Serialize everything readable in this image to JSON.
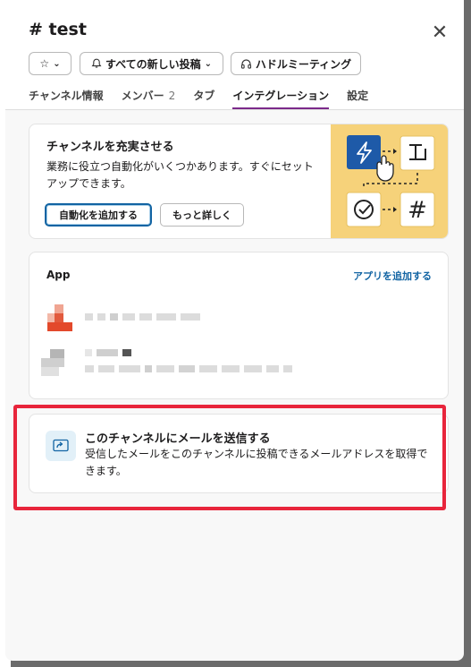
{
  "channel": {
    "title": "# test"
  },
  "header_buttons": {
    "star_chevron": "⌄",
    "notifications_label": "すべての新しい投稿",
    "huddle_label": "ハドルミーティング"
  },
  "tabs": [
    {
      "label": "チャンネル情報",
      "count": ""
    },
    {
      "label": "メンバー",
      "count": "2"
    },
    {
      "label": "タブ",
      "count": ""
    },
    {
      "label": "インテグレーション",
      "count": "",
      "active": true
    },
    {
      "label": "設定",
      "count": ""
    }
  ],
  "enrich_card": {
    "title": "チャンネルを充実させる",
    "description": "業務に役立つ自動化がいくつかあります。すぐにセットアップできます。",
    "add_automation_label": "自動化を追加する",
    "learn_more_label": "もっと詳しく"
  },
  "apps_card": {
    "title": "App",
    "add_app_label": "アプリを追加する"
  },
  "email_card": {
    "title": "このチャンネルにメールを送信する",
    "description": "受信したメールをこのチャンネルに投稿できるメールアドレスを取得できます。"
  },
  "colors": {
    "accent": "#1264a3",
    "tab_underline": "#7b2a8a",
    "highlight": "#e8253b",
    "illustration_bg": "#f6d27a"
  }
}
